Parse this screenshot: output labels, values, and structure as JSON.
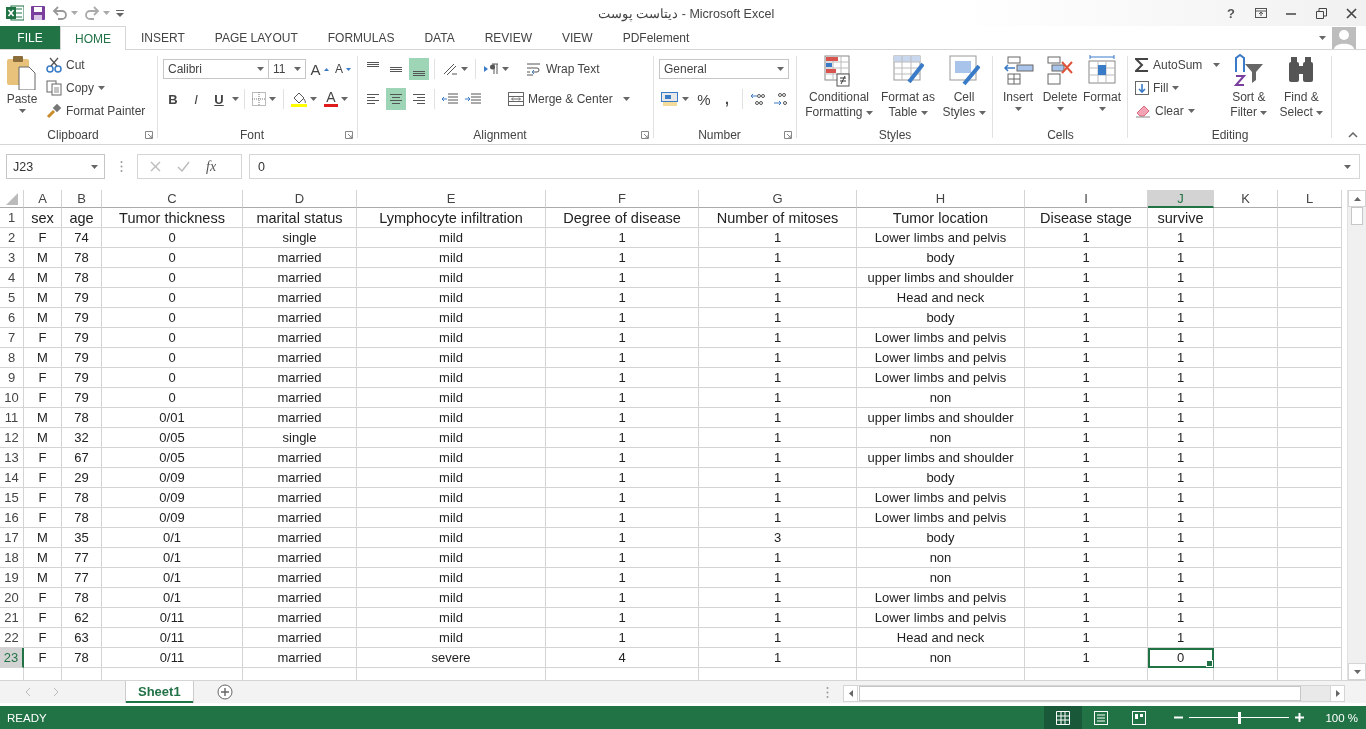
{
  "window": {
    "title": "دیتاست پوست - Microsoft Excel",
    "help": "?"
  },
  "tabs": [
    {
      "label": "FILE",
      "kind": "file",
      "selected": false
    },
    {
      "label": "HOME",
      "kind": "tab",
      "selected": true
    },
    {
      "label": "INSERT",
      "kind": "tab",
      "selected": false
    },
    {
      "label": "PAGE LAYOUT",
      "kind": "tab",
      "selected": false
    },
    {
      "label": "FORMULAS",
      "kind": "tab",
      "selected": false
    },
    {
      "label": "DATA",
      "kind": "tab",
      "selected": false
    },
    {
      "label": "REVIEW",
      "kind": "tab",
      "selected": false
    },
    {
      "label": "VIEW",
      "kind": "tab",
      "selected": false
    },
    {
      "label": "PDFelement",
      "kind": "tab",
      "selected": false
    }
  ],
  "ribbon": {
    "clipboard": {
      "label": "Clipboard",
      "paste": "Paste",
      "cut": "Cut",
      "copy": "Copy",
      "format_painter": "Format Painter"
    },
    "font": {
      "label": "Font",
      "font_name": "Calibri",
      "font_size": "11",
      "grow": "A",
      "shrink": "A",
      "bold": "B",
      "italic": "I",
      "underline": "U",
      "font_color": "A"
    },
    "alignment": {
      "label": "Alignment",
      "wrap_text": "Wrap Text",
      "merge_center": "Merge & Center",
      "vertical_align": [
        {
          "selected": false
        },
        {
          "selected": false
        },
        {
          "selected": true
        }
      ],
      "horizontal_align": [
        {
          "selected": false
        },
        {
          "selected": true
        },
        {
          "selected": false
        }
      ]
    },
    "number": {
      "label": "Number",
      "format": "General",
      "percent": "%",
      "comma": ","
    },
    "styles": {
      "label": "Styles",
      "buttons": [
        "Conditional Formatting",
        "Format as Table",
        "Cell Styles"
      ]
    },
    "cells": {
      "label": "Cells",
      "buttons": [
        "Insert",
        "Delete",
        "Format"
      ]
    },
    "editing": {
      "label": "Editing",
      "autosum": "AutoSum",
      "fill": "Fill",
      "clear": "Clear",
      "sort_filter": "Sort & Filter",
      "find_select": "Find & Select"
    }
  },
  "formula_bar": {
    "name_box": "J23",
    "fx": "fx",
    "value": "0"
  },
  "columns": [
    {
      "letter": "A",
      "selected": false
    },
    {
      "letter": "B",
      "selected": false
    },
    {
      "letter": "C",
      "selected": false
    },
    {
      "letter": "D",
      "selected": false
    },
    {
      "letter": "E",
      "selected": false
    },
    {
      "letter": "F",
      "selected": false
    },
    {
      "letter": "G",
      "selected": false
    },
    {
      "letter": "H",
      "selected": false
    },
    {
      "letter": "I",
      "selected": false
    },
    {
      "letter": "J",
      "selected": true
    },
    {
      "letter": "K",
      "selected": false
    },
    {
      "letter": "L",
      "selected": false
    }
  ],
  "rows": [
    {
      "number": "1",
      "selected": false,
      "cells": [
        "sex",
        "age",
        "Tumor thickness",
        "marital status",
        "Lymphocyte infiltration",
        "Degree of disease",
        "Number of mitoses",
        "Tumor location",
        "Disease stage",
        "survive"
      ]
    },
    {
      "number": "2",
      "selected": false,
      "cells": [
        "F",
        "74",
        "0",
        "single",
        "mild",
        "1",
        "1",
        "Lower limbs and pelvis",
        "1",
        "1"
      ]
    },
    {
      "number": "3",
      "selected": false,
      "cells": [
        "M",
        "78",
        "0",
        "married",
        "mild",
        "1",
        "1",
        "body",
        "1",
        "1"
      ]
    },
    {
      "number": "4",
      "selected": false,
      "cells": [
        "M",
        "78",
        "0",
        "married",
        "mild",
        "1",
        "1",
        "upper limbs and shoulder",
        "1",
        "1"
      ]
    },
    {
      "number": "5",
      "selected": false,
      "cells": [
        "M",
        "79",
        "0",
        "married",
        "mild",
        "1",
        "1",
        "Head and neck",
        "1",
        "1"
      ]
    },
    {
      "number": "6",
      "selected": false,
      "cells": [
        "M",
        "79",
        "0",
        "married",
        "mild",
        "1",
        "1",
        "body",
        "1",
        "1"
      ]
    },
    {
      "number": "7",
      "selected": false,
      "cells": [
        "F",
        "79",
        "0",
        "married",
        "mild",
        "1",
        "1",
        "Lower limbs and pelvis",
        "1",
        "1"
      ]
    },
    {
      "number": "8",
      "selected": false,
      "cells": [
        "M",
        "79",
        "0",
        "married",
        "mild",
        "1",
        "1",
        "Lower limbs and pelvis",
        "1",
        "1"
      ]
    },
    {
      "number": "9",
      "selected": false,
      "cells": [
        "F",
        "79",
        "0",
        "married",
        "mild",
        "1",
        "1",
        "Lower limbs and pelvis",
        "1",
        "1"
      ]
    },
    {
      "number": "10",
      "selected": false,
      "cells": [
        "F",
        "79",
        "0",
        "married",
        "mild",
        "1",
        "1",
        "non",
        "1",
        "1"
      ]
    },
    {
      "number": "11",
      "selected": false,
      "cells": [
        "M",
        "78",
        "0/01",
        "married",
        "mild",
        "1",
        "1",
        "upper limbs and shoulder",
        "1",
        "1"
      ]
    },
    {
      "number": "12",
      "selected": false,
      "cells": [
        "M",
        "32",
        "0/05",
        "single",
        "mild",
        "1",
        "1",
        "non",
        "1",
        "1"
      ]
    },
    {
      "number": "13",
      "selected": false,
      "cells": [
        "F",
        "67",
        "0/05",
        "married",
        "mild",
        "1",
        "1",
        "upper limbs and shoulder",
        "1",
        "1"
      ]
    },
    {
      "number": "14",
      "selected": false,
      "cells": [
        "F",
        "29",
        "0/09",
        "married",
        "mild",
        "1",
        "1",
        "body",
        "1",
        "1"
      ]
    },
    {
      "number": "15",
      "selected": false,
      "cells": [
        "F",
        "78",
        "0/09",
        "married",
        "mild",
        "1",
        "1",
        "Lower limbs and pelvis",
        "1",
        "1"
      ]
    },
    {
      "number": "16",
      "selected": false,
      "cells": [
        "F",
        "78",
        "0/09",
        "married",
        "mild",
        "1",
        "1",
        "Lower limbs and pelvis",
        "1",
        "1"
      ]
    },
    {
      "number": "17",
      "selected": false,
      "cells": [
        "M",
        "35",
        "0/1",
        "married",
        "mild",
        "1",
        "3",
        "body",
        "1",
        "1"
      ]
    },
    {
      "number": "18",
      "selected": false,
      "cells": [
        "M",
        "77",
        "0/1",
        "married",
        "mild",
        "1",
        "1",
        "non",
        "1",
        "1"
      ]
    },
    {
      "number": "19",
      "selected": false,
      "cells": [
        "M",
        "77",
        "0/1",
        "married",
        "mild",
        "1",
        "1",
        "non",
        "1",
        "1"
      ]
    },
    {
      "number": "20",
      "selected": false,
      "cells": [
        "F",
        "78",
        "0/1",
        "married",
        "mild",
        "1",
        "1",
        "Lower limbs and pelvis",
        "1",
        "1"
      ]
    },
    {
      "number": "21",
      "selected": false,
      "cells": [
        "F",
        "62",
        "0/11",
        "married",
        "mild",
        "1",
        "1",
        "Lower limbs and pelvis",
        "1",
        "1"
      ]
    },
    {
      "number": "22",
      "selected": false,
      "cells": [
        "F",
        "63",
        "0/11",
        "married",
        "mild",
        "1",
        "1",
        "Head and neck",
        "1",
        "1"
      ]
    },
    {
      "number": "23",
      "selected": true,
      "cells": [
        "F",
        "78",
        "0/11",
        "married",
        "severe",
        "4",
        "1",
        "non",
        "1",
        "0"
      ]
    }
  ],
  "sheets": [
    {
      "name": "Sheet1",
      "selected": true
    }
  ],
  "status_bar": {
    "status": "READY",
    "views": [
      {
        "selected": true
      },
      {
        "selected": false
      },
      {
        "selected": false
      }
    ],
    "zoom_slider": {
      "level": 0.5
    },
    "zoom": "100 %"
  }
}
